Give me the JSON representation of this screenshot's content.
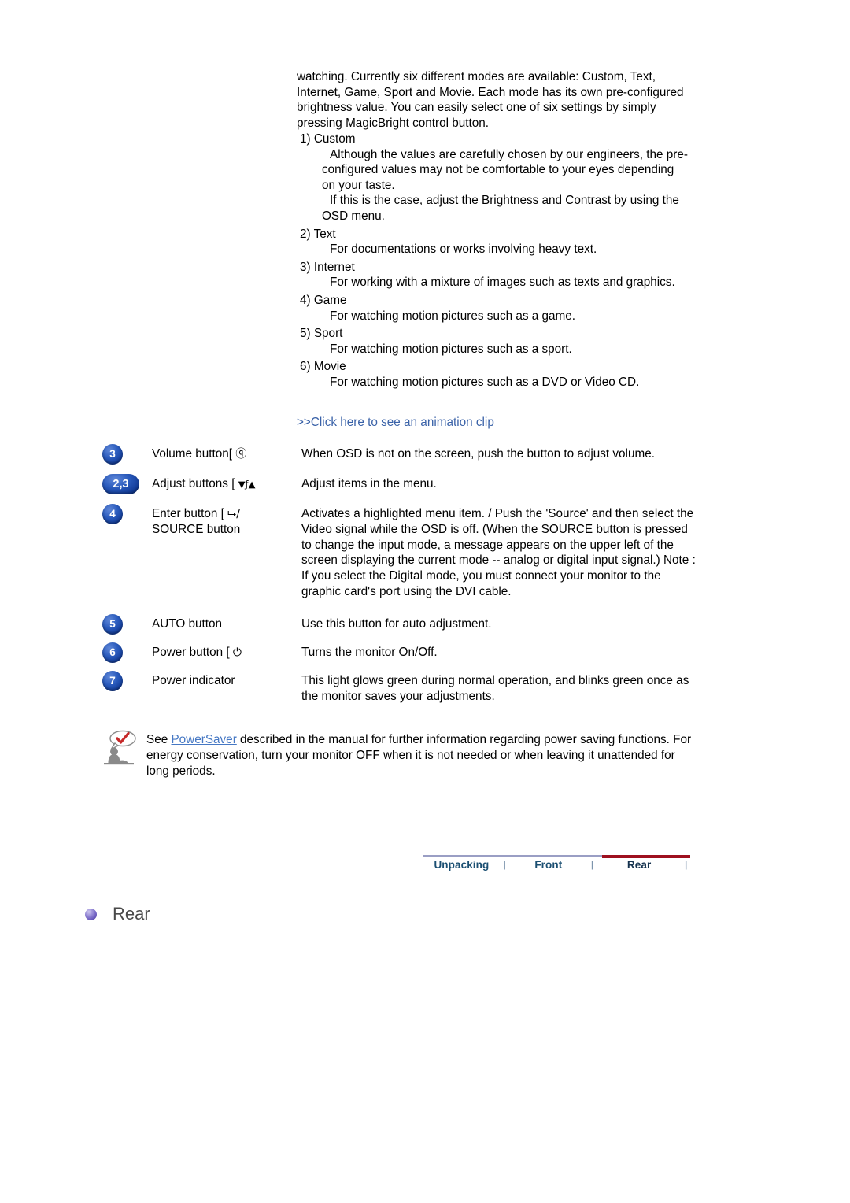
{
  "intro": {
    "paragraph": "watching. Currently six different modes are available: Custom, Text, Internet, Game, Sport and Movie. Each mode has its own pre-configured brightness value. You can easily select one of six settings by simply pressing MagicBright  control button."
  },
  "modes": [
    {
      "head": "1) Custom",
      "desc1": "Although the values are carefully chosen by our engineers, the pre-configured values may not be comfortable to your eyes depending on your taste.",
      "desc2": "If this is the case, adjust the Brightness and Contrast by using the OSD menu."
    },
    {
      "head": "2) Text",
      "desc1": "For documentations or works involving heavy text.",
      "desc2": ""
    },
    {
      "head": "3) Internet",
      "desc1": "For working with a mixture of images such as texts and graphics.",
      "desc2": ""
    },
    {
      "head": "4) Game",
      "desc1": "For watching motion pictures such as a game.",
      "desc2": ""
    },
    {
      "head": "5) Sport",
      "desc1": "For watching motion pictures such as a sport.",
      "desc2": ""
    },
    {
      "head": "6) Movie",
      "desc1": "For watching motion pictures such as a DVD or Video CD.",
      "desc2": ""
    }
  ],
  "animation_link": {
    "label": ">>Click here to see an animation clip",
    "color": "#3a62a8"
  },
  "button_rows": [
    {
      "badge": "3",
      "badge_wide": false,
      "label": "Volume button[",
      "icon": "volume-speaker-icon",
      "icon_glyph": "ⓠ",
      "description": "When OSD is not on the screen, push the button to adjust volume."
    },
    {
      "badge": "2,3",
      "badge_wide": true,
      "label": "Adjust buttons [",
      "icon": "down-up-arrows-icon",
      "icon_glyph": "▼ƒ▲",
      "description": "Adjust items in the menu."
    },
    {
      "badge": "4",
      "badge_wide": false,
      "label_line1": "Enter button [",
      "label_line2": "SOURCE button",
      "icon": "enter-source-icon",
      "icon_glyph": "⮡/",
      "description": "Activates a highlighted menu item. / Push the 'Source' and then select the Video signal while the OSD is off. (When the SOURCE button is pressed to change the input mode, a message appears on the upper left of the screen displaying the current mode -- analog or digital input signal.) Note : If you select the Digital mode, you must connect your monitor to the graphic card's port using the DVI cable."
    },
    {
      "badge": "5",
      "badge_wide": false,
      "label": "AUTO button",
      "icon": "",
      "icon_glyph": "",
      "description": "Use this button for auto adjustment."
    },
    {
      "badge": "6",
      "badge_wide": false,
      "label": "Power button [",
      "icon": "power-symbol-icon",
      "icon_glyph": "⏻",
      "description": "Turns the monitor On/Off."
    },
    {
      "badge": "7",
      "badge_wide": false,
      "label": "Power indicator",
      "icon": "",
      "icon_glyph": "",
      "description": "This light glows green during normal operation, and blinks green once as the monitor saves your adjustments."
    }
  ],
  "note": {
    "icon": "person-speech-bubble-check-icon",
    "text_before": "See ",
    "link_label": "PowerSaver",
    "text_after": " described in the manual for further information regarding power saving functions. For energy conservation, turn your monitor OFF when it is not needed or when leaving it unattended for long periods.",
    "link_color": "#4678c4"
  },
  "tabbar": {
    "tabs": [
      {
        "label": "Unpacking",
        "active": false
      },
      {
        "label": "Front",
        "active": false
      },
      {
        "label": "Rear",
        "active": true
      }
    ],
    "separator": "|",
    "line_color": "#9a9ec4",
    "active_color": "#9e101f"
  },
  "section": {
    "title": "Rear",
    "bullet_color": "#6f5fc0"
  }
}
